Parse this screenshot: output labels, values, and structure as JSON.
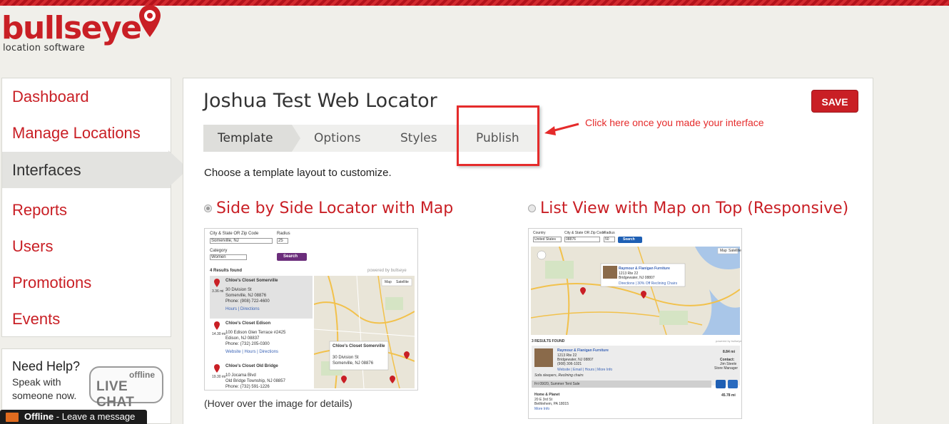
{
  "brand": {
    "name": "bullseye",
    "tagline": "location software",
    "color": "#c91f25"
  },
  "sidebar": {
    "items": [
      {
        "label": "Dashboard",
        "active": false
      },
      {
        "label": "Manage Locations",
        "active": false
      },
      {
        "label": "Interfaces",
        "active": true
      },
      {
        "label": "Reports",
        "active": false
      },
      {
        "label": "Users",
        "active": false
      },
      {
        "label": "Promotions",
        "active": false
      },
      {
        "label": "Events",
        "active": false
      }
    ]
  },
  "help": {
    "title": "Need Help?",
    "text": "Speak with someone now.",
    "chat_status": "offline",
    "chat_label": "LIVE CHAT",
    "bar_status": "Offline",
    "bar_text": " - Leave a message"
  },
  "page": {
    "title": "Joshua Test Web Locator",
    "save_label": "SAVE",
    "tabs": [
      {
        "label": "Template",
        "active": true
      },
      {
        "label": "Options",
        "active": false
      },
      {
        "label": "Styles",
        "active": false
      },
      {
        "label": "Publish",
        "active": false
      }
    ],
    "annotation": "Click here once you made your interface",
    "intro": "Choose a template layout to customize.",
    "hover_note": "(Hover over the image for details)",
    "templates": [
      {
        "title": "Side by Side Locator with Map",
        "selected": true,
        "preview": {
          "field1_label": "City & State OR Zip Code",
          "field1_value": "Somerville, NJ",
          "radius_label": "Radius",
          "radius_value": "25",
          "category_label": "Category",
          "category_value": "Women",
          "search_label": "Search",
          "results_count": "4 Results found",
          "powered_by": "powered by bullseye",
          "map_tab": "Map",
          "satellite_tab": "Satellite",
          "results": [
            {
              "name": "Chloe's Closet Somerville",
              "distance": "3.36 mi",
              "address1": "30 Division St",
              "address2": "Somerville, NJ 08876",
              "phone": "Phone: (908) 722-4600",
              "links": "Hours | Directions"
            },
            {
              "name": "Chloe's Closet Edison",
              "distance": "14.30 mi",
              "address1": "100 Edison Glen Terrace #2425",
              "address2": "Edison, NJ 08837",
              "phone": "Phone: (732) 205-0300",
              "links": "Website | Hours | Directions"
            },
            {
              "name": "Chloe's Closet Old Bridge",
              "distance": "19.30 mi",
              "address1": "10 Jocama Blvd",
              "address2": "Old Bridge Township, NJ 08857",
              "phone": "Phone: (732) 591-1226",
              "links": ""
            }
          ],
          "popup_name": "Chloe's Closet Somerville",
          "popup_addr1": "30 Division St",
          "popup_addr2": "Somerville, NJ 08876"
        }
      },
      {
        "title": "List View with Map on Top (Responsive)",
        "selected": false,
        "preview": {
          "country_label": "Country",
          "country_value": "United States",
          "field1_label": "City & State OR Zip Code",
          "field1_value": "08876",
          "radius_label": "Radius",
          "radius_value": "50",
          "search_label": "Search",
          "map_tab": "Map",
          "satellite_tab": "Satellite",
          "popup_name": "Raymour & Flanigan Furniture",
          "popup_addr1": "1213 Rte 22",
          "popup_addr2": "Bridgewater, NJ 08807",
          "popup_links": "Directions | 30% Off Reclining Chairs",
          "results_count": "3 RESULTS FOUND",
          "powered_by": "powered by bullseye",
          "r1_name": "Raymour & Flanigan Furniture",
          "r1_addr1": "1213 Rte 22",
          "r1_addr2": "Bridgewater, NJ 08807",
          "r1_phone": "(908) 306-1021",
          "r1_distance": "8.84 mi",
          "r1_contact_label": "Contact:",
          "r1_contact_name": "Jim Steele",
          "r1_contact_role": "Store Manager",
          "r1_links": "Website | Email | Hours | More Info",
          "r1_note": "Sofa sleepers, Reclining chairs",
          "r1_event": "Fri 09/20, Summer Tent Sale",
          "r2_name": "Home & Planet",
          "r2_addr1": "20 E 3rd St",
          "r2_addr2": "Bethlehem, PA 18015",
          "r2_links": "More Info",
          "r2_distance": "45.78 mi"
        }
      }
    ]
  }
}
